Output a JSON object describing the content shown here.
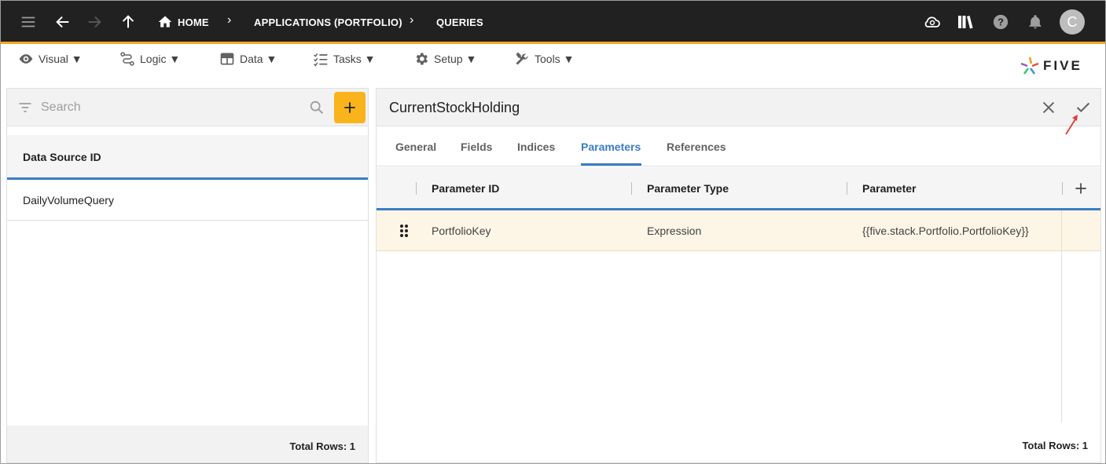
{
  "topbar": {
    "breadcrumbs": [
      "HOME",
      "APPLICATIONS (PORTFOLIO)",
      "QUERIES"
    ],
    "avatar_initial": "C",
    "icons": [
      "menu-icon",
      "back-icon",
      "forward-icon",
      "up-icon",
      "home-icon",
      "cloud-sync-icon",
      "library-icon",
      "help-icon",
      "bell-icon"
    ]
  },
  "menubar": {
    "items": [
      {
        "label": "Visual ▼",
        "icon": "eye-icon"
      },
      {
        "label": "Logic ▼",
        "icon": "logic-icon"
      },
      {
        "label": "Data ▼",
        "icon": "table-icon"
      },
      {
        "label": "Tasks ▼",
        "icon": "checklist-icon"
      },
      {
        "label": "Setup ▼",
        "icon": "gear-icon"
      },
      {
        "label": "Tools ▼",
        "icon": "tools-icon"
      }
    ],
    "logo_text": "FIVE"
  },
  "left_panel": {
    "search_placeholder": "Search",
    "column_header": "Data Source ID",
    "rows": [
      "DailyVolumeQuery"
    ],
    "footer": "Total Rows: 1"
  },
  "right_panel": {
    "title": "CurrentStockHolding",
    "tabs": [
      "General",
      "Fields",
      "Indices",
      "Parameters",
      "References"
    ],
    "active_tab": "Parameters",
    "columns": [
      "Parameter ID",
      "Parameter Type",
      "Parameter"
    ],
    "rows": [
      {
        "parameter_id": "PortfolioKey",
        "parameter_type": "Expression",
        "parameter": "{{five.stack.Portfolio.PortfolioKey}}"
      }
    ],
    "footer": "Total Rows: 1"
  },
  "colors": {
    "topbar_bg": "#212121",
    "accent_orange": "#f9b41b",
    "accent_blue": "#3b7dc4",
    "selected_row": "#fdf5e6",
    "annotation_arrow": "#e53935"
  }
}
